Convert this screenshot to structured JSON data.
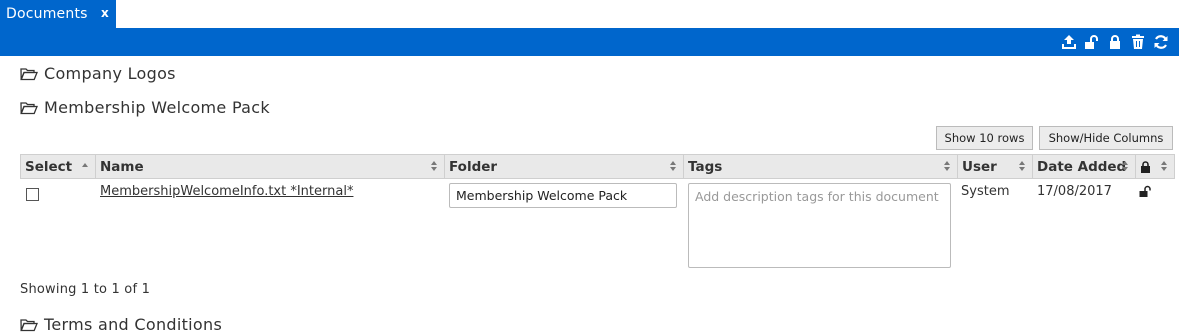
{
  "tab": {
    "title": "Documents",
    "close_label": "x"
  },
  "toolbar": {
    "icons": [
      "upload-icon",
      "unlock-icon",
      "lock-icon",
      "trash-icon",
      "refresh-icon"
    ],
    "color": "#0066cc"
  },
  "folders_top": [
    {
      "name": "Company Logos"
    },
    {
      "name": "Membership Welcome Pack"
    }
  ],
  "table_controls": {
    "show_rows_label": "Show 10 rows",
    "show_hide_columns_label": "Show/Hide Columns"
  },
  "table": {
    "columns": [
      "Select",
      "Name",
      "Folder",
      "Tags",
      "User",
      "Date Added"
    ],
    "rows": [
      {
        "name": "MembershipWelcomeInfo.txt *Internal*",
        "folder": "Membership Welcome Pack",
        "tags_placeholder": "Add description tags for this document",
        "user": "System",
        "date_added": "17/08/2017"
      }
    ]
  },
  "footer": {
    "showing": "Showing 1 to 1 of 1"
  },
  "folders_bottom": [
    {
      "name": "Terms and Conditions"
    }
  ]
}
